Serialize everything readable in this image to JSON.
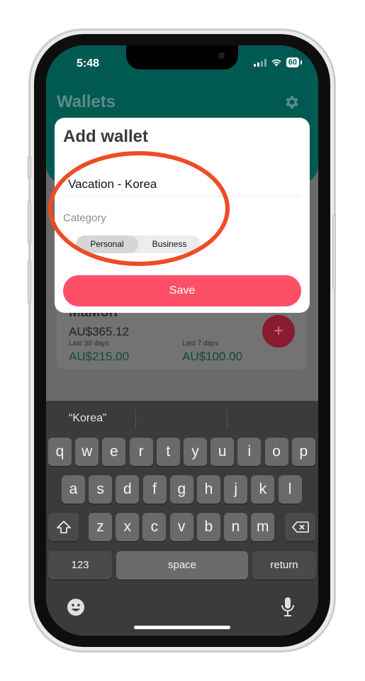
{
  "status_bar": {
    "time": "5:48",
    "battery": "60"
  },
  "app": {
    "title": "Wallets"
  },
  "wallet": {
    "name": "MaMon",
    "total": "AU$365.12",
    "stat1_label": "Last 30 days",
    "stat1_value": "AU$215.00",
    "stat2_label": "Last 7 days",
    "stat2_value": "AU$100.00",
    "fab_label": "+"
  },
  "modal": {
    "title": "Add wallet",
    "name_value": "Vacation - Korea",
    "category_label": "Category",
    "options": [
      "Personal",
      "Business"
    ],
    "selected": "Personal",
    "save_label": "Save"
  },
  "keyboard": {
    "suggestion": "“Korea”",
    "row1": [
      "q",
      "w",
      "e",
      "r",
      "t",
      "y",
      "u",
      "i",
      "o",
      "p"
    ],
    "row2": [
      "a",
      "s",
      "d",
      "f",
      "g",
      "h",
      "j",
      "k",
      "l"
    ],
    "row3": [
      "z",
      "x",
      "c",
      "v",
      "b",
      "n",
      "m"
    ],
    "numbers_label": "123",
    "space_label": "space",
    "return_label": "return"
  },
  "colors": {
    "header": "#005a52",
    "accent": "#fd5066",
    "annotation": "#ee4c27"
  }
}
